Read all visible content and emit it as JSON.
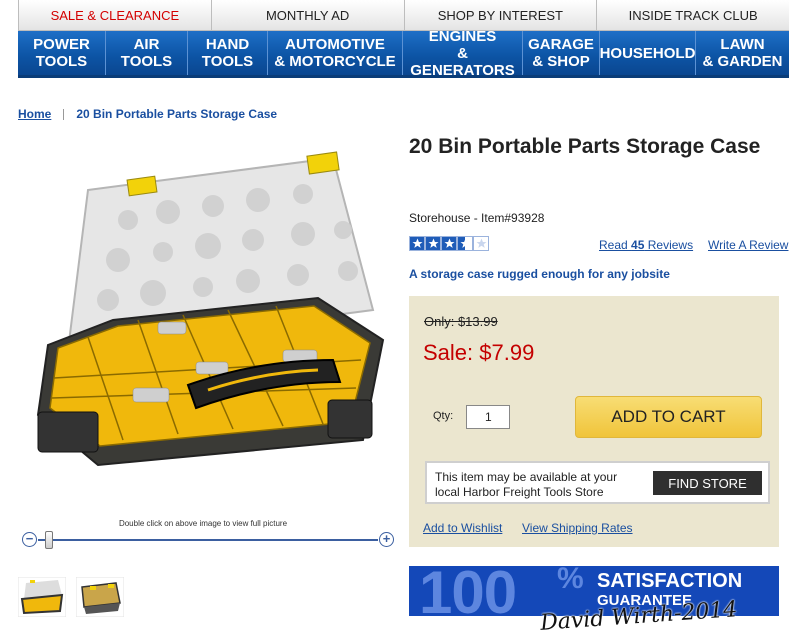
{
  "top_tabs": [
    {
      "label": "SALE & CLEARANCE"
    },
    {
      "label": "MONTHLY AD"
    },
    {
      "label": "SHOP BY INTEREST"
    },
    {
      "label": "INSIDE TRACK CLUB"
    }
  ],
  "main_nav": [
    {
      "label": "POWER\nTOOLS"
    },
    {
      "label": "AIR\nTOOLS"
    },
    {
      "label": "HAND\nTOOLS"
    },
    {
      "label": "AUTOMOTIVE\n& MOTORCYCLE"
    },
    {
      "label": "ENGINES\n& GENERATORS"
    },
    {
      "label": "GARAGE\n& SHOP"
    },
    {
      "label": "HOUSEHOLD"
    },
    {
      "label": "LAWN\n& GARDEN"
    }
  ],
  "breadcrumb": {
    "home": "Home",
    "current": "20 Bin Portable Parts Storage Case"
  },
  "image": {
    "caption": "Double click on above image to view full picture",
    "zoom_minus": "−",
    "zoom_plus": "+",
    "zoom_level": 0.05
  },
  "product": {
    "title": "20 Bin Portable Parts Storage Case",
    "brand_line": "Storehouse - Item#93928",
    "rating": 3.5,
    "rating_max": 5,
    "reviews_prefix": "Read ",
    "reviews_count": "45",
    "reviews_suffix": " Reviews",
    "write_review": "Write A Review",
    "tagline": "A storage case rugged enough for any jobsite"
  },
  "pricing": {
    "only_label": "Only: $13.99",
    "sale_label": "Sale: $7.99",
    "qty_label": "Qty:",
    "qty_value": "1",
    "add_to_cart": "ADD TO CART",
    "store_text": "This item may be available at your local Harbor Freight Tools Store",
    "find_store": "FIND STORE",
    "wishlist": "Add to Wishlist",
    "shipping": "View Shipping Rates"
  },
  "guarantee": {
    "big": "100",
    "pct": "%",
    "line1": "SATISFACTION",
    "line2": "GUARANTEE"
  },
  "signature": "David Wirth-2014",
  "colors": {
    "nav_blue": "#0d55a6",
    "sale_red": "#c40000",
    "link_blue": "#1a4fa0",
    "cart_yellow": "#f0c43a",
    "price_bg": "#ebe6cf"
  }
}
